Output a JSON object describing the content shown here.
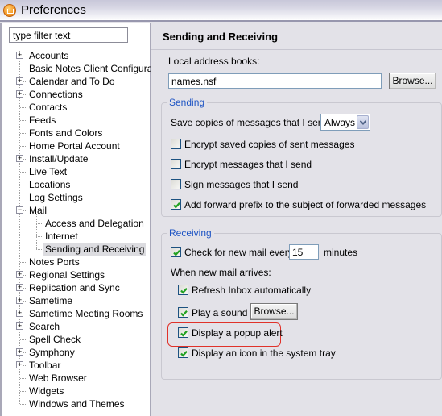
{
  "window": {
    "title": "Preferences",
    "icon": "lotus-notes-icon"
  },
  "filter": {
    "placeholder": "type filter text",
    "value": "type filter text"
  },
  "tree": [
    {
      "label": "Accounts",
      "expandable": true,
      "expanded": false,
      "level": 0
    },
    {
      "label": "Basic Notes Client Configuration",
      "expandable": false,
      "level": 0
    },
    {
      "label": "Calendar and To Do",
      "expandable": true,
      "expanded": false,
      "level": 0
    },
    {
      "label": "Connections",
      "expandable": true,
      "expanded": false,
      "level": 0
    },
    {
      "label": "Contacts",
      "expandable": false,
      "level": 0
    },
    {
      "label": "Feeds",
      "expandable": false,
      "level": 0
    },
    {
      "label": "Fonts and Colors",
      "expandable": false,
      "level": 0
    },
    {
      "label": "Home Portal Account",
      "expandable": false,
      "level": 0
    },
    {
      "label": "Install/Update",
      "expandable": true,
      "expanded": false,
      "level": 0
    },
    {
      "label": "Live Text",
      "expandable": false,
      "level": 0
    },
    {
      "label": "Locations",
      "expandable": false,
      "level": 0
    },
    {
      "label": "Log Settings",
      "expandable": false,
      "level": 0
    },
    {
      "label": "Mail",
      "expandable": true,
      "expanded": true,
      "level": 0
    },
    {
      "label": "Access and Delegation",
      "expandable": false,
      "level": 1
    },
    {
      "label": "Internet",
      "expandable": false,
      "level": 1
    },
    {
      "label": "Sending and Receiving",
      "expandable": false,
      "level": 1,
      "selected": true
    },
    {
      "label": "Notes Ports",
      "expandable": false,
      "level": 0
    },
    {
      "label": "Regional Settings",
      "expandable": true,
      "expanded": false,
      "level": 0
    },
    {
      "label": "Replication and Sync",
      "expandable": true,
      "expanded": false,
      "level": 0
    },
    {
      "label": "Sametime",
      "expandable": true,
      "expanded": false,
      "level": 0
    },
    {
      "label": "Sametime Meeting Rooms",
      "expandable": true,
      "expanded": false,
      "level": 0
    },
    {
      "label": "Search",
      "expandable": true,
      "expanded": false,
      "level": 0
    },
    {
      "label": "Spell Check",
      "expandable": false,
      "level": 0
    },
    {
      "label": "Symphony",
      "expandable": true,
      "expanded": false,
      "level": 0
    },
    {
      "label": "Toolbar",
      "expandable": true,
      "expanded": false,
      "level": 0
    },
    {
      "label": "Web Browser",
      "expandable": false,
      "level": 0
    },
    {
      "label": "Widgets",
      "expandable": false,
      "level": 0
    },
    {
      "label": "Windows and Themes",
      "expandable": false,
      "level": 0
    }
  ],
  "page": {
    "title": "Sending and Receiving",
    "address_books_label": "Local address books:",
    "address_books_value": "names.nsf",
    "browse_label": "Browse...",
    "sending": {
      "title": "Sending",
      "save_copies_label": "Save copies of messages that I send:",
      "save_copies_value": "Always",
      "options": [
        {
          "label": "Encrypt saved copies of sent messages",
          "checked": false
        },
        {
          "label": "Encrypt messages that I send",
          "checked": false
        },
        {
          "label": "Sign messages that I send",
          "checked": false
        },
        {
          "label": "Add forward prefix to the subject of forwarded messages",
          "checked": true
        }
      ]
    },
    "receiving": {
      "title": "Receiving",
      "check_mail_label": "Check for new mail every",
      "check_mail_checked": true,
      "check_mail_minutes": "15",
      "minutes_label": "minutes",
      "when_arrives_label": "When new mail arrives:",
      "options": [
        {
          "label": "Refresh Inbox automatically",
          "checked": true
        },
        {
          "label": "Play a sound",
          "checked": true
        },
        {
          "label": "Display a popup alert",
          "checked": true,
          "highlighted": true
        },
        {
          "label": "Display an icon in the system tray",
          "checked": true
        }
      ],
      "sound_browse_label": "Browse..."
    }
  },
  "colors": {
    "group_title": "#1f55c4",
    "highlight": "#e0322a",
    "check": "#21a121"
  }
}
